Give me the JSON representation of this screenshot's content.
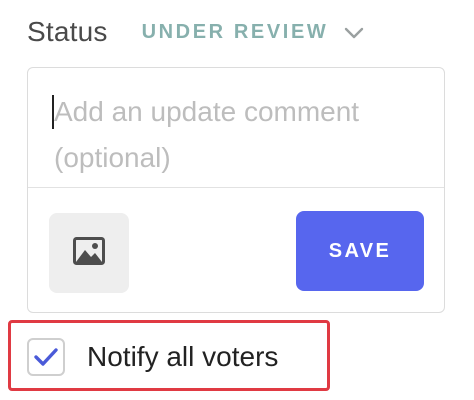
{
  "status": {
    "label": "Status",
    "value": "UNDER REVIEW",
    "value_color": "#87b0ad"
  },
  "comment": {
    "placeholder": "Add an update comment (optional)",
    "value": ""
  },
  "actions": {
    "image_icon": "image-icon",
    "save_label": "SAVE",
    "save_color": "#5766ee"
  },
  "notify": {
    "label": "Notify all voters",
    "checked": true,
    "check_color": "#4a5ad8",
    "highlight_color": "#e03a43"
  }
}
